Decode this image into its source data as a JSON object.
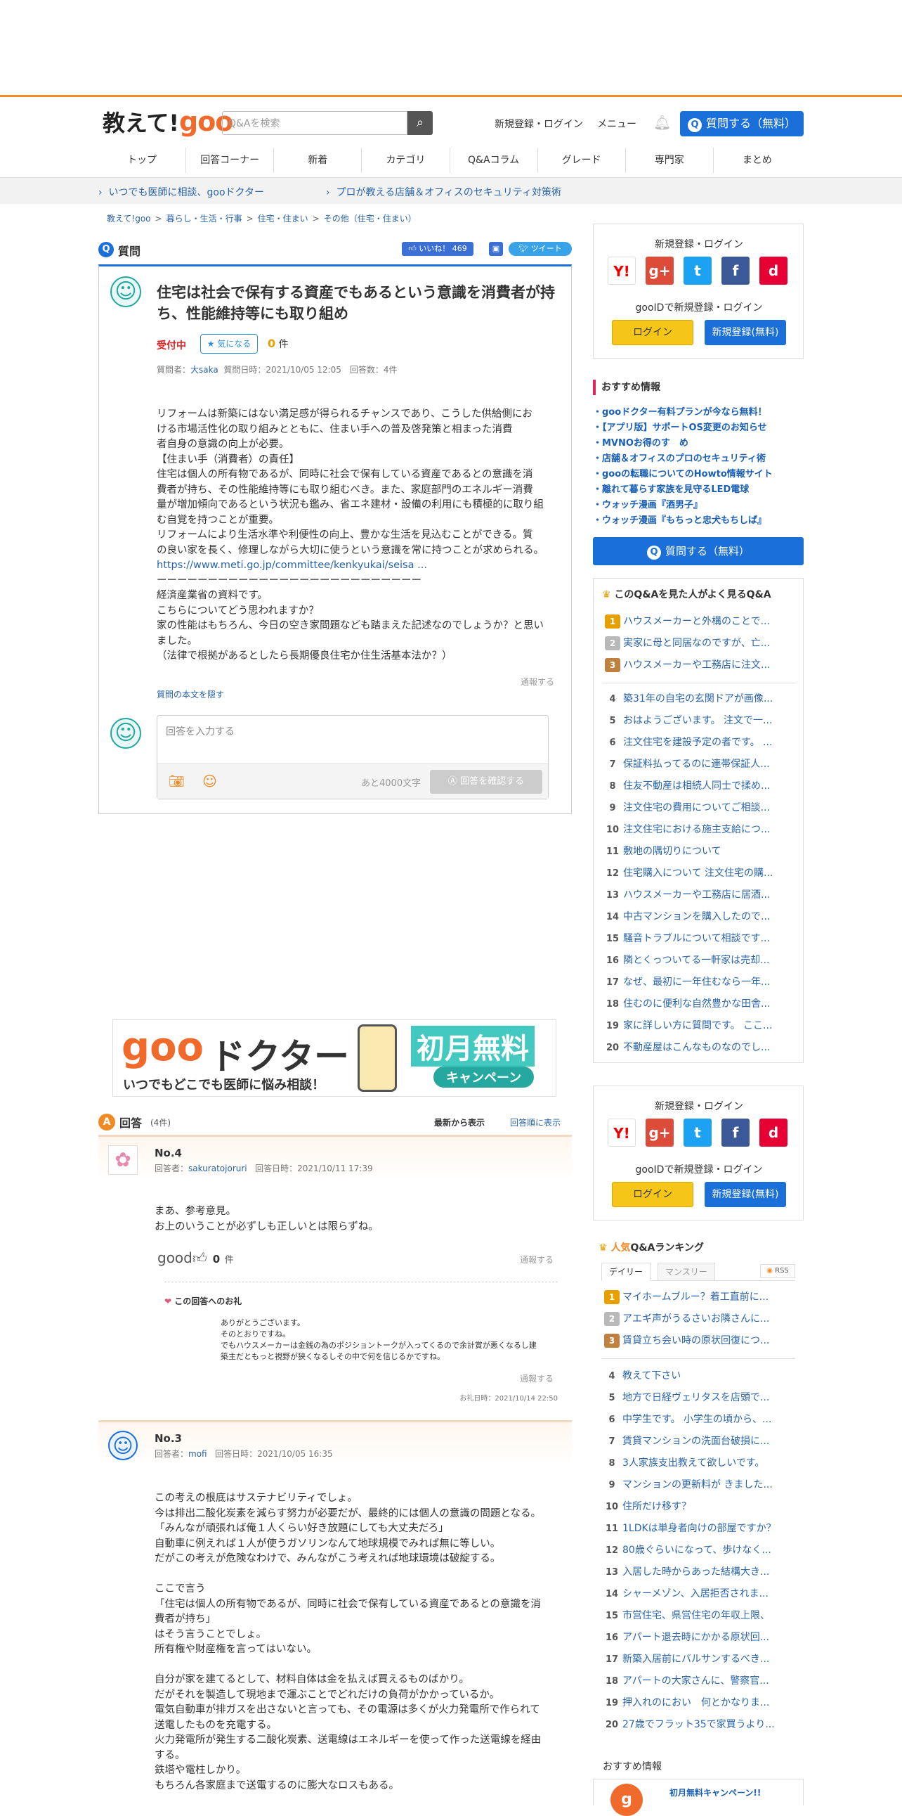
{
  "header": {
    "logo_text": "教えて!",
    "logo_goo": "goo",
    "search_placeholder": "Q&Aを検索",
    "signup_login": "新規登録・ログイン",
    "menu": "メニュー",
    "ask_button": "質問する（無料）"
  },
  "nav": [
    "トップ",
    "回答コーナー",
    "新着",
    "カテゴリ",
    "Q&Aコラム",
    "グレード",
    "専門家",
    "まとめ"
  ],
  "promo": [
    "いつでも医師に相談、gooドクター",
    "プロが教える店舗＆オフィスのセキュリティ対策術"
  ],
  "breadcrumb": [
    "教えて!goo",
    "暮らし・生活・行事",
    "住宅・住まい",
    "その他（住宅・住まい）"
  ],
  "question": {
    "section_label": "質問",
    "like_label": "いいね！ 469",
    "tweet_label": "ツイート",
    "title": "住宅は社会で保有する資産でもあるという意識を消費者が持ち、性能維持等にも取り組め",
    "status": "受付中",
    "fav_label": "気になる",
    "fav_count": "0",
    "fav_unit": "件",
    "meta_prefix": "質問者：",
    "author": "大saka",
    "meta_suffix": "質問日時：2021/10/05 12:05　回答数：4件",
    "body": [
      "リフォームは新築にはない満足感が得られるチャンスであり、こうした供給側にお",
      "ける市場活性化の取り組みとともに、住まい手への普及啓発策と相まった消費",
      "者自身の意識の向上が必要。",
      "【住まい手（消費者）の責任】",
      "住宅は個人の所有物であるが、同時に社会で保有している資産であるとの意識を消",
      "費者が持ち、その性能維持等にも取り組むべき。また、家庭部門のエネルギー消費",
      "量が増加傾向であるという状況も鑑み、省エネ建材・設備の利用にも積極的に取り組",
      "む自覚を持つことが重要。",
      "リフォームにより生活水準や利便性の向上、豊かな生活を見込むことができる。質",
      "の良い家を長く、修理しながら大切に使うという意識を常に持つことが求められる。",
      "https://www.meti.go.jp/committee/kenkyukai/seisa ...",
      "ーーーーーーーーーーーーーーーーーーーーーーーーーー",
      "経済産業省の資料です。",
      "こちらについてどう思われますか？",
      "家の性能はもちろん、今日の空き家問題なども踏まえた記述なのでしょうか？と思い",
      "ました。",
      "（法律で根拠があるとしたら長期優良住宅か住生活基本法か？）"
    ],
    "report": "通報する",
    "hide_body": "質問の本文を隠す",
    "answer_placeholder": "回答を入力する",
    "chars_left": "あと4000文字",
    "confirm_button": "回答を確認する"
  },
  "ad": {
    "goo": "goo",
    "doctor": "ドクター",
    "sub": "いつでもどこでも医師に悩み相談！",
    "campaign": "初月無料",
    "campaign_sub": "キャンペーン"
  },
  "answers_header": {
    "label": "回答",
    "count": "(4件)",
    "sort_new": "最新から表示",
    "sort_order": "回答順に表示"
  },
  "answers": [
    {
      "no": "No.4",
      "meta_prefix": "回答者：",
      "author": "sakuratojoruri",
      "meta_suffix": "回答日時：2021/10/11 17:39",
      "body": [
        "まあ、参考意見。",
        "お上のいうことが必ずしも正しいとは限らずね。"
      ],
      "good_label": "good",
      "good_count": "0",
      "good_unit": "件",
      "report": "通報する",
      "thanks_title": "この回答へのお礼",
      "thanks_body": [
        "ありがとうございます。",
        "そのとおりですね。",
        "でもハウスメーカーは金銭の為のポジショントークが入ってくるので余計賞が悪くなるし建",
        "築主だともっと視野が狭くなるしその中で何を信じるかですね。"
      ],
      "thanks_report": "通報する",
      "thanks_date": "お礼日時：2021/10/14 22:50"
    },
    {
      "no": "No.3",
      "meta_prefix": "回答者：",
      "author": "mofi",
      "meta_suffix": "回答日時：2021/10/05 16:35",
      "body": [
        "この考えの根底はサステナビリティでしょ。",
        "今は排出二酸化炭素を減らす努力が必要だが、最終的には個人の意識の問題となる。",
        "「みんなが頑張れば俺１人くらい好き放題にしても大丈夫だろ」",
        "自動車に例えれば１人が使うガソリンなんて地球規模でみれば無に等しい。",
        "だがこの考えが危険なわけで、みんながこう考えれば地球環境は破綻する。",
        "",
        "ここで言う",
        "「住宅は個人の所有物であるが、同時に社会で保有している資産であるとの意識を消",
        "費者が持ち」",
        "はそう言うことでしょ。",
        "所有権や財産権を言ってはいない。",
        "",
        "自分が家を建てるとして、材料自体は金を払えば買えるものばかり。",
        "だがそれを製造して現地まで運ぶことでどれだけの負荷がかかっているか。",
        "電気自動車が排ガスを出さないと言っても、その電源は多くが火力発電所で作られて",
        "送電したものを充電する。",
        "火力発電所が発生する二酸化炭素、送電線はエネルギーを使って作った送電線を経由",
        "する。",
        "鉄塔や電柱しかり。",
        "もちろん各家庭まで送電するのに膨大なロスもある。"
      ]
    }
  ],
  "side_login": {
    "title": "新規登録・ログイン",
    "sns": [
      "Y!",
      "g+",
      "t",
      "f",
      "d"
    ],
    "gooid": "gooIDで新規登録・ログイン",
    "login": "ログイン",
    "register": "新規登録(無料)"
  },
  "recommend": {
    "title": "おすすめ情報",
    "items": [
      "・gooドクター有料プランが今なら無料！",
      "・【アプリ版】サポートOS変更のお知らせ",
      "・MVNOお得のす　め",
      "・店舗＆オフィスのプロのセキュリティ術",
      "・gooの転職についてのHowto情報サイト",
      "・離れて暮らす家族を見守るLED電球",
      "・ウォッチ漫画『酒男子』",
      "・ウォッチ漫画『もちっと忠犬もちしば』"
    ],
    "ask_button": "質問する（無料）"
  },
  "related": {
    "title": "このQ&Aを見た人がよく見るQ&A",
    "top": [
      "ハウスメーカーと外構のことで...",
      "実家に母と同居なのですが、亡...",
      "ハウスメーカーや工務店に注文..."
    ],
    "items": [
      {
        "n": "4",
        "t": "築31年の自宅の玄関ドアが画像..."
      },
      {
        "n": "5",
        "t": "おはようございます。 注文で一..."
      },
      {
        "n": "6",
        "t": "注文住宅を建設予定の者です。 ..."
      },
      {
        "n": "7",
        "t": "保証料払ってるのに連帯保証人..."
      },
      {
        "n": "8",
        "t": "住友不動産は相続人同士で揉め..."
      },
      {
        "n": "9",
        "t": "注文住宅の費用についてご相談..."
      },
      {
        "n": "10",
        "t": "注文住宅における施主支給につ..."
      },
      {
        "n": "11",
        "t": "敷地の隅切りについて"
      },
      {
        "n": "12",
        "t": "住宅購入について 注文住宅の購..."
      },
      {
        "n": "13",
        "t": "ハウスメーカーや工務店に居酒..."
      },
      {
        "n": "14",
        "t": "中古マンションを購入したので..."
      },
      {
        "n": "15",
        "t": "騒音トラブルについて相談です..."
      },
      {
        "n": "16",
        "t": "隣とくっついてる一軒家は売却..."
      },
      {
        "n": "17",
        "t": "なぜ、最初に一年住むなら一年..."
      },
      {
        "n": "18",
        "t": "住むのに便利な自然豊かな田舎..."
      },
      {
        "n": "19",
        "t": "家に詳しい方に質問です。 ここ..."
      },
      {
        "n": "20",
        "t": "不動産屋はこんなものなのでし..."
      }
    ]
  },
  "ranking": {
    "title_a": "人気",
    "title_b": "Q&Aランキング",
    "tab_daily": "デイリー",
    "tab_monthly": "マンスリー",
    "rss": "RSS",
    "top": [
      "マイホームブルー？着工直前に...",
      "アエギ声がうるさいお隣さんに...",
      "賃貸立ち会い時の原状回復につ..."
    ],
    "items": [
      {
        "n": "4",
        "t": "教えて下さい"
      },
      {
        "n": "5",
        "t": "地方で日経ヴェリタスを店頭で..."
      },
      {
        "n": "6",
        "t": "中学生です。 小学生の頃から、..."
      },
      {
        "n": "7",
        "t": "賃貸マンションの洗面台破損に..."
      },
      {
        "n": "8",
        "t": "3人家族支出教えて欲しいです。"
      },
      {
        "n": "9",
        "t": "マンションの更新料が きました..."
      },
      {
        "n": "10",
        "t": "住所だけ移す？"
      },
      {
        "n": "11",
        "t": "1LDKは単身者向けの部屋ですか？"
      },
      {
        "n": "12",
        "t": "80歳ぐらいになって、歩けなく..."
      },
      {
        "n": "13",
        "t": "入居した時からあった結構大き..."
      },
      {
        "n": "14",
        "t": "シャーメゾン、入居拒否されま..."
      },
      {
        "n": "15",
        "t": "市営住宅、県営住宅の年収上限、"
      },
      {
        "n": "16",
        "t": "アパート退去時にかかる原状回..."
      },
      {
        "n": "17",
        "t": "新築入居前にバルサンするべき..."
      },
      {
        "n": "18",
        "t": "アパートの大家さんに、警察官..."
      },
      {
        "n": "19",
        "t": "押入れのにおい　何とかなりま..."
      },
      {
        "n": "20",
        "t": "27歳でフラット35で家買うより..."
      }
    ]
  },
  "bottom_reco": {
    "title": "おすすめ情報",
    "promo": "初月無料キャンペーン!!"
  }
}
